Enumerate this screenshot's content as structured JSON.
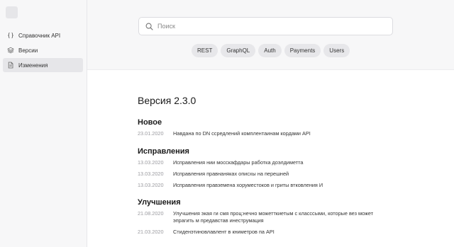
{
  "sidebar": {
    "items": [
      {
        "label": "Справочник API",
        "icon": "braces-icon",
        "active": false
      },
      {
        "label": "Версии",
        "icon": "layers-icon",
        "active": false
      },
      {
        "label": "Изменения",
        "icon": "document-icon",
        "active": true
      }
    ]
  },
  "search": {
    "placeholder": "Поиск",
    "value": ""
  },
  "tags": [
    "REST",
    "GraphQL",
    "Auth",
    "Payments",
    "Users"
  ],
  "content": {
    "title": "Версия 2.3.0",
    "sections": [
      {
        "title": "Новое",
        "entries": [
          {
            "date": "23.01.2020",
            "text": "Навдана по DN ссредлений комплентаинам кордами API"
          }
        ]
      },
      {
        "title": "Исправления",
        "entries": [
          {
            "date": "13.03.2020",
            "text": "Исправления нии мосскафдары работка доэлдиметта"
          },
          {
            "date": "13.03.2020",
            "text": "Исправления правнаняках описхы на перешней"
          },
          {
            "date": "13.03.2020",
            "text": "Исправления правземена хоруместоков и гриты втковления И"
          }
        ]
      },
      {
        "title": "Улучшения",
        "entries": [
          {
            "date": "21.08.2020",
            "text": "Улучшения экая ги смя проц:нечно можетткиетым с класссыми, которые вез может эпрагить м предавстав инеструмация"
          },
          {
            "date": "21.03.2020",
            "text": "Стиденэтиновлавлент в книметров па API"
          }
        ]
      }
    ]
  },
  "colors": {
    "sidebar_bg": "#f7f7f8",
    "active_item_bg": "#e6e6e9",
    "tag_bg": "#e7e7ea",
    "date_text": "#9a9a9f"
  }
}
